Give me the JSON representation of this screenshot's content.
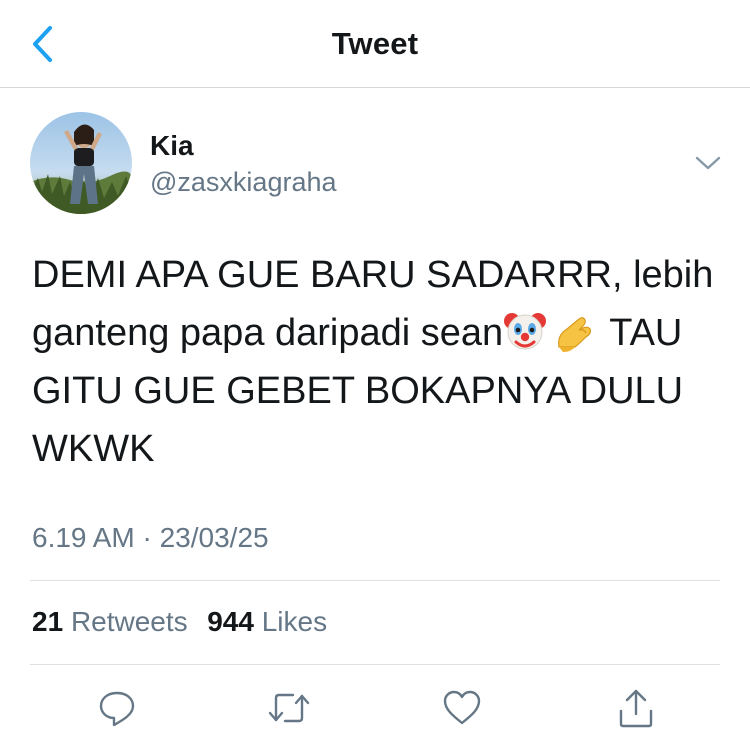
{
  "header": {
    "title": "Tweet",
    "back_icon": "chevron-left-icon",
    "accent_color": "#1da1f2"
  },
  "author": {
    "display_name": "Kia",
    "handle": "@zasxkiagraha",
    "avatar": "avatar-photo"
  },
  "tweet": {
    "lines": [
      "DEMI APA GUE BARU SADARRR, lebih",
      "ganteng papa daripadi sean",
      "TAU",
      "GITU GUE GEBET BOKAPNYA DULU",
      "WKWK"
    ],
    "emojis": [
      "clown-face-emoji",
      "pinching-hand-emoji"
    ],
    "timestamp": "6.19 AM · 23/03/25"
  },
  "stats": {
    "retweets_count": "21",
    "retweets_label": "Retweets",
    "likes_count": "944",
    "likes_label": "Likes"
  },
  "actions": [
    "reply-icon",
    "retweet-icon",
    "like-icon",
    "share-icon"
  ],
  "colors": {
    "text": "#14171a",
    "secondary": "#657786",
    "divider": "#dde1e4"
  }
}
